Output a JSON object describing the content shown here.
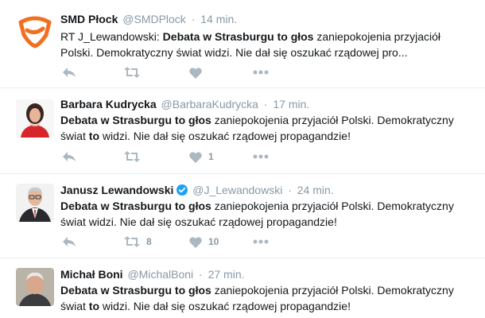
{
  "colors": {
    "accent_verified": "#1da1f2",
    "action_icon": "#aab8c2",
    "muted": "#8899a6",
    "smd_orange": "#f26f21"
  },
  "tweets": [
    {
      "fullname": "SMD Płock",
      "username": "@SMDPlock",
      "sep": "·",
      "time": "14 min.",
      "verified": false,
      "text_parts": [
        "RT J_Lewandowski: ",
        "Debata w Strasburgu to głos",
        " zaniepokojenia przyjaciół Polski. Demokratyczny świat widzi. Nie dał się oszukać rządowej pro..."
      ],
      "retweets": "",
      "likes": "",
      "avatar_icon": "smd-logo-icon"
    },
    {
      "fullname": "Barbara Kudrycka",
      "username": "@BarbaraKudrycka",
      "sep": "·",
      "time": "17 min.",
      "verified": false,
      "text_parts": [
        "Debata w Strasburgu to głos",
        " zaniepokojenia przyjaciół Polski. Demokratyczny świat ",
        "to",
        " widzi. Nie dał się oszukać rządowej propagandzie!"
      ],
      "retweets": "",
      "likes": "1",
      "avatar_icon": "user-avatar"
    },
    {
      "fullname": "Janusz Lewandowski",
      "username": "@J_Lewandowski",
      "sep": "·",
      "time": "24 min.",
      "verified": true,
      "text_parts": [
        "Debata w Strasburgu to głos",
        " zaniepokojenia przyjaciół Polski. Demokratyczny świat widzi. Nie dał się oszukać rządowej propagandzie!"
      ],
      "retweets": "8",
      "likes": "10",
      "avatar_icon": "user-avatar"
    },
    {
      "fullname": "Michał Boni",
      "username": "@MichalBoni",
      "sep": "·",
      "time": "27 min.",
      "verified": false,
      "text_parts": [
        "Debata w Strasburgu to głos",
        " zaniepokojenia przyjaciół Polski. Demokratyczny świat ",
        "to",
        " widzi. Nie dał się oszukać rządowej propagandzie!"
      ],
      "retweets": "",
      "likes": "",
      "avatar_icon": "user-avatar"
    }
  ]
}
